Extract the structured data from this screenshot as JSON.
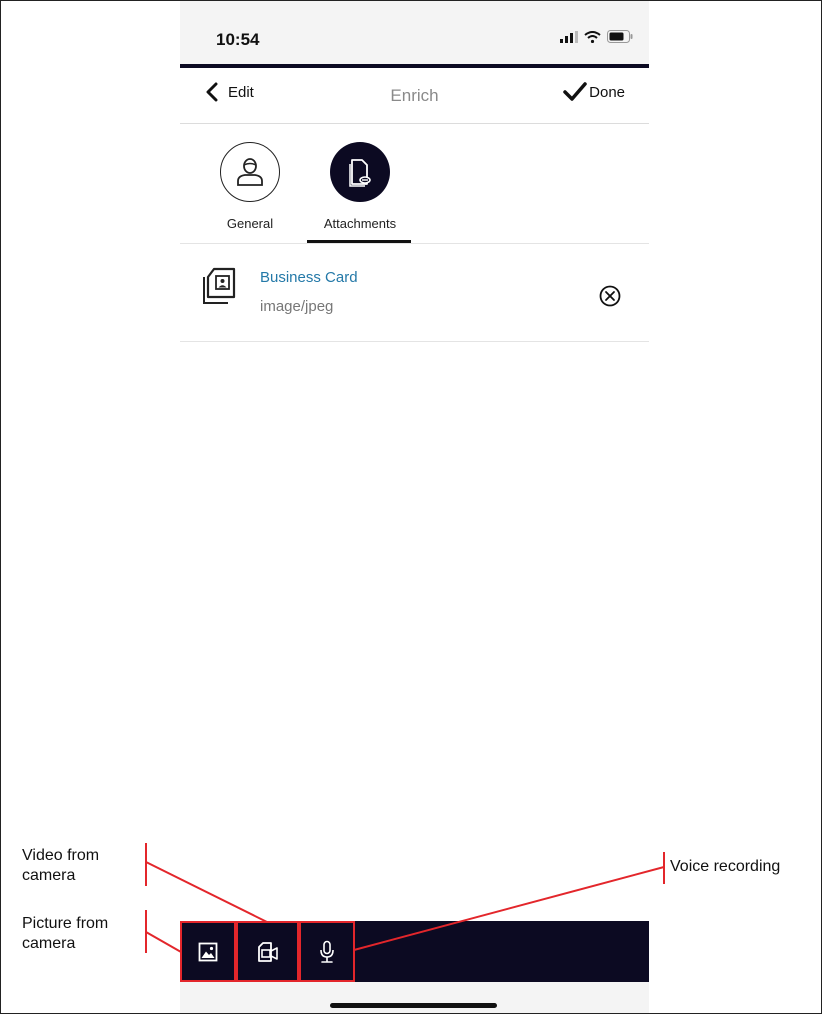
{
  "status_bar": {
    "time": "10:54"
  },
  "nav": {
    "back_label": "Edit",
    "title": "Enrich",
    "done_label": "Done"
  },
  "tabs": [
    {
      "label": "General",
      "icon": "person-icon",
      "selected": false
    },
    {
      "label": "Attachments",
      "icon": "attachment-icon",
      "selected": true
    }
  ],
  "attachment": {
    "name": "Business Card",
    "type": "image/jpeg",
    "icon": "image-file-icon"
  },
  "toolbar": {
    "items": [
      {
        "icon": "picture-icon"
      },
      {
        "icon": "video-camera-icon"
      },
      {
        "icon": "microphone-icon"
      }
    ]
  },
  "annotations": {
    "video": [
      "Video from",
      "camera"
    ],
    "picture": [
      "Picture from",
      "camera"
    ],
    "voice": "Voice recording"
  },
  "colors": {
    "dark_navy": "#0c0a22",
    "link_blue": "#2479a8",
    "annotation_red": "#e3262b"
  }
}
